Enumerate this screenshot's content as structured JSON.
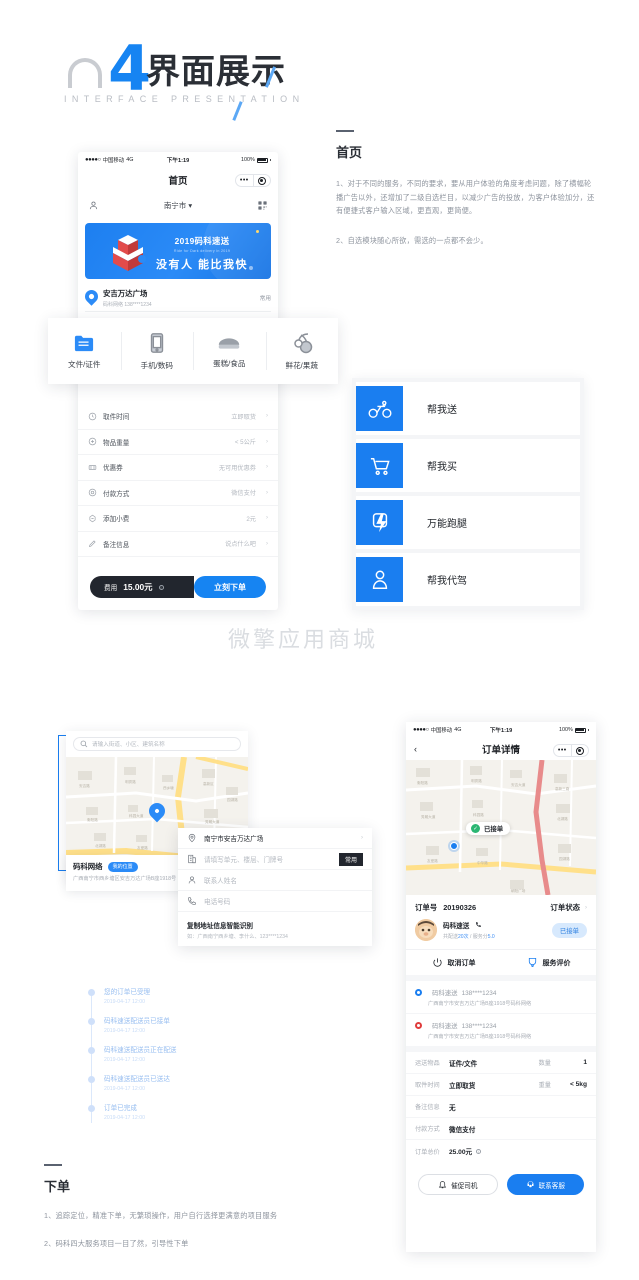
{
  "header": {
    "number": "4",
    "title_cn": "界面展示",
    "title_en": "INTERFACE PRESENTATION"
  },
  "home_desc": {
    "title": "首页",
    "p1": "1、对于不同的服务，不同的要求，要从用户体验的角度考虑问题，除了横幅轮播广告以外，还增加了二级自选栏目，以减少广告的投放，为客户体验加分，还有便捷式客户输入区域，更直观，更简便。",
    "p2": "2、自选模块随心所欲，需选的一点都不会少。"
  },
  "order_desc": {
    "title": "下单",
    "p1": "1、追踪定位，精准下单，无繁琐操作，用户自行选择更满意的项目服务",
    "p2": "2、码科四大服务项目一目了然，引导性下单"
  },
  "watermark": "微擎应用商城",
  "phone1": {
    "status": {
      "carrier": "中国移动",
      "network": "4G",
      "time": "下午1:19",
      "battery": "100%"
    },
    "nav_title": "首页",
    "city": "南宁市",
    "banner": {
      "line1": "2019码科速送",
      "line2": "Ride for Dark delivery in 2019",
      "line3": "没有人  能比我快"
    },
    "address": {
      "name": "安吉万达广场",
      "sub": "码科网络  138****1234",
      "tag": "常用"
    },
    "categories": [
      {
        "label": "文件/证件",
        "icon": "folder-icon"
      },
      {
        "label": "手机/数码",
        "icon": "phone-icon"
      },
      {
        "label": "蛋糕/食品",
        "icon": "cake-icon"
      },
      {
        "label": "鲜花/果蔬",
        "icon": "fruit-icon"
      }
    ],
    "form_rows": [
      {
        "label": "取件时间",
        "value": "立即取货",
        "icon": "clock-icon"
      },
      {
        "label": "物品重量",
        "value": "< 5公斤",
        "icon": "weight-icon"
      },
      {
        "label": "优惠券",
        "value": "无可用优惠券",
        "icon": "coupon-icon"
      },
      {
        "label": "付款方式",
        "value": "微信支付",
        "icon": "wallet-icon"
      },
      {
        "label": "添加小费",
        "value": "2元",
        "icon": "tip-icon"
      },
      {
        "label": "备注信息",
        "value": "说点什么吧",
        "icon": "pencil-icon"
      }
    ],
    "order_bar": {
      "fee_label": "费用",
      "fee_value": "15.00元",
      "button": "立刻下单"
    }
  },
  "services": [
    {
      "label": "帮我送",
      "icon": "bicycle-icon"
    },
    {
      "label": "帮我买",
      "icon": "cart-icon"
    },
    {
      "label": "万能跑腿",
      "icon": "lightning-icon"
    },
    {
      "label": "帮我代驾",
      "icon": "driver-icon"
    }
  ],
  "map_block": {
    "search_placeholder": "请输入街道、小区、建筑名称",
    "poi_name": "码科网络",
    "poi_badge": "我的位置",
    "poi_address": "广西南宁市西乡塘区安吉万达广场B座1918号"
  },
  "address_card": {
    "rows": [
      {
        "text": "南宁市安吉万达广场",
        "icon": "location-icon",
        "placeholder": false,
        "chevron": true
      },
      {
        "text": "请填写单元、楼层、门牌号",
        "icon": "building-icon",
        "placeholder": true,
        "tag": "常用"
      },
      {
        "text": "联系人姓名",
        "icon": "person-icon",
        "placeholder": true
      },
      {
        "text": "电话号码",
        "icon": "phone-call-icon",
        "placeholder": true
      }
    ],
    "copy_title": "复制地址信息智能识别",
    "copy_sub": "如：广西南宁西乡塘、李什么、123****1234"
  },
  "timeline": [
    {
      "text": "您的订单已受理",
      "time": "2019-04-17 12:00"
    },
    {
      "text": "码科速送配送员已接单",
      "time": "2019-04-17 12:00"
    },
    {
      "text": "码科速送配送员正在配送",
      "time": "2019-04-17 12:00"
    },
    {
      "text": "码科速送配送员已送达",
      "time": "2019-04-17 12:00"
    },
    {
      "text": "订单已完成",
      "time": "2019-04-17 12:00"
    }
  ],
  "phone2": {
    "status": {
      "carrier": "中国移动",
      "network": "4G",
      "time": "下午1:19",
      "battery": "100%"
    },
    "nav_title": "订单详情",
    "map_badge": "已接单",
    "order_no_label": "订单号",
    "order_no": "20190326",
    "order_status_label": "订单状态",
    "courier": {
      "name": "码科速送",
      "stats_prefix": "共配送",
      "stats_count": "20次",
      "stats_mid": " / 服务分",
      "stats_score": "5.0",
      "badge": "已接单"
    },
    "actions": [
      {
        "label": "取消订单",
        "icon": "power-icon"
      },
      {
        "label": "服务评价",
        "icon": "medal-icon"
      }
    ],
    "points": [
      {
        "name": "码科速送",
        "phone": "138****1234",
        "address": "广西南宁市安吉万达广场B座1918号码科网络",
        "color": "blue"
      },
      {
        "name": "码科速送",
        "phone": "138****1234",
        "address": "广西南宁市安吉万达广场B座1918号码科网络",
        "color": "red"
      }
    ],
    "details": [
      {
        "key": "运送物品",
        "value": "证件/文件",
        "key2": "数量",
        "value2": "1"
      },
      {
        "key": "取件时间",
        "value": "立即取货",
        "key2": "重量",
        "value2": "< 5kg"
      },
      {
        "key": "备注信息",
        "value": "无"
      },
      {
        "key": "付款方式",
        "value": "微信支付"
      },
      {
        "key": "订单总价",
        "value": "25.00元"
      }
    ],
    "buttons": [
      {
        "label": "催促司机",
        "icon": "bell-icon",
        "style": "outline"
      },
      {
        "label": "联系客服",
        "icon": "headset-icon",
        "style": "filled"
      }
    ]
  }
}
